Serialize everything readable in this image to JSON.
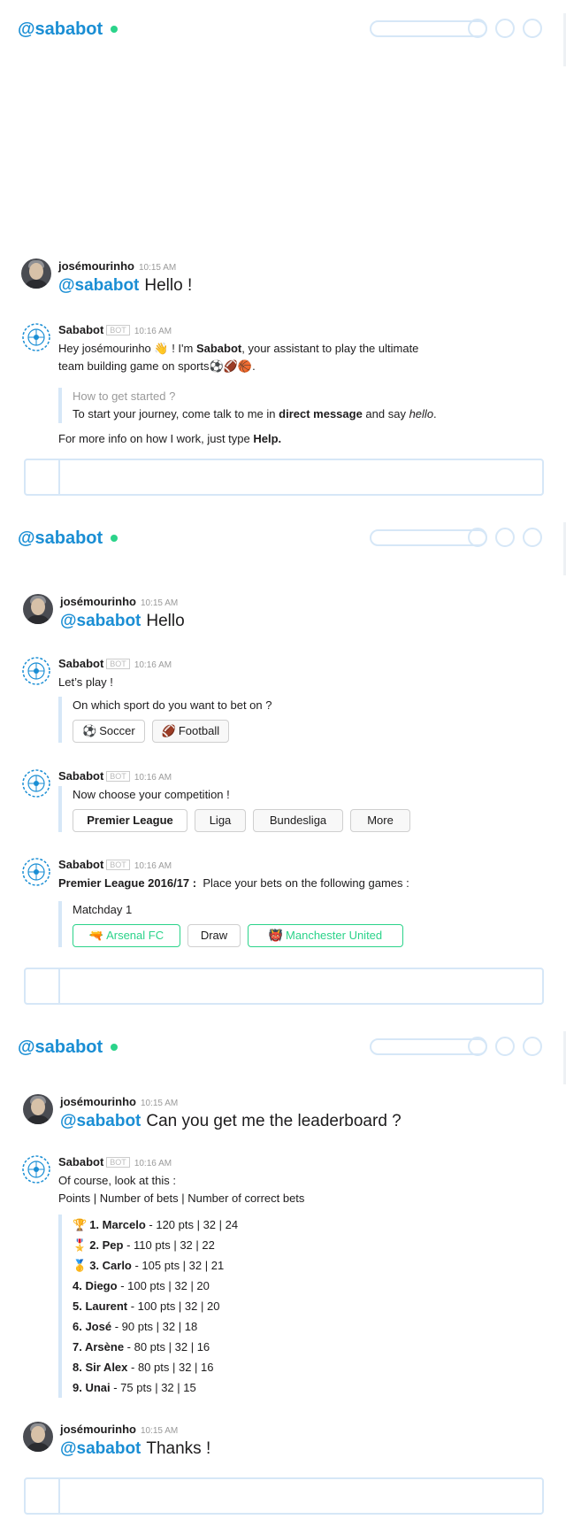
{
  "channel": "@sababot",
  "panel1": {
    "user_name": "josémourinho",
    "user_time": "10:15 AM",
    "user_mention": "@sababot",
    "user_text": "Hello !",
    "bot_name": "Sababot",
    "bot_badge": "BOT",
    "bot_time": "10:16 AM",
    "intro_1": "Hey josémourinho ",
    "intro_wave": "👋",
    "intro_2": " ! I'm ",
    "intro_bold": "Sababot",
    "intro_3": ", your assistant to play the ultimate",
    "intro_4": "team building game on sports",
    "intro_emojis": "⚽🏈🏀",
    "intro_end": ".",
    "started_title": "How to get started ?",
    "started_1": "To start your journey, come talk to me in ",
    "started_bold": "direct message",
    "started_2": " and say ",
    "started_italic": "hello",
    "started_end": ".",
    "info_1": "For more info on how I work, just type ",
    "info_bold": "Help."
  },
  "panel2": {
    "user_name": "josémourinho",
    "user_time": "10:15 AM",
    "user_mention": "@sababot",
    "user_text": "Hello",
    "bot_name": "Sababot",
    "bot_badge": "BOT",
    "bot_time": "10:16 AM",
    "lets_play": "Let’s play !",
    "sport_q": "On which sport do you want to bet on ?",
    "sport_buttons": [
      {
        "icon": "⚽",
        "label": "Soccer"
      },
      {
        "icon": "🏈",
        "label": "Football"
      }
    ],
    "comp_q": "Now choose your competition !",
    "comp_buttons": [
      "Premier League",
      "Liga",
      "Bundesliga",
      "More"
    ],
    "league_bold": "Premier League 2016/17 :",
    "league_text": "Place your bets on the following games :",
    "matchday": "Matchday 1",
    "match_buttons": [
      {
        "icon": "🔫",
        "label": "Arsenal FC"
      },
      {
        "icon": "",
        "label": "Draw"
      },
      {
        "icon": "👹",
        "label": "Manchester United"
      }
    ]
  },
  "panel3": {
    "user_name": "josémourinho",
    "user_time": "10:15 AM",
    "user_mention": "@sababot",
    "user_text": "Can you get me the leaderboard ?",
    "bot_name": "Sababot",
    "bot_badge": "BOT",
    "bot_time": "10:16 AM",
    "lb_intro": "Of course, look at this :",
    "lb_columns": "Points | Number of bets | Number of correct bets",
    "leaderboard": [
      {
        "medal": "🏆",
        "name": "1. Marcelo",
        "stats": " - 120 pts | 32 | 24"
      },
      {
        "medal": "🎖️",
        "name": "2. Pep",
        "stats": " - 110 pts | 32 | 22"
      },
      {
        "medal": "🥇",
        "name": "3. Carlo",
        "stats": " - 105 pts | 32 | 21"
      },
      {
        "medal": "",
        "name": "4. Diego",
        "stats": " - 100 pts | 32 | 20"
      },
      {
        "medal": "",
        "name": "5. Laurent",
        "stats": " - 100 pts | 32 | 20"
      },
      {
        "medal": "",
        "name": "6. José",
        "stats": " - 90 pts | 32 | 18"
      },
      {
        "medal": "",
        "name": "7. Arsène",
        "stats": " - 80 pts | 32 | 16"
      },
      {
        "medal": "",
        "name": "8. Sir Alex",
        "stats": " - 80 pts | 32 | 16"
      },
      {
        "medal": "",
        "name": "9. Unai",
        "stats": " - 75 pts | 32 | 15"
      }
    ],
    "thanks_user_name": "josémourinho",
    "thanks_time": "10:15 AM",
    "thanks_mention": "@sababot",
    "thanks_text": "Thanks !"
  }
}
